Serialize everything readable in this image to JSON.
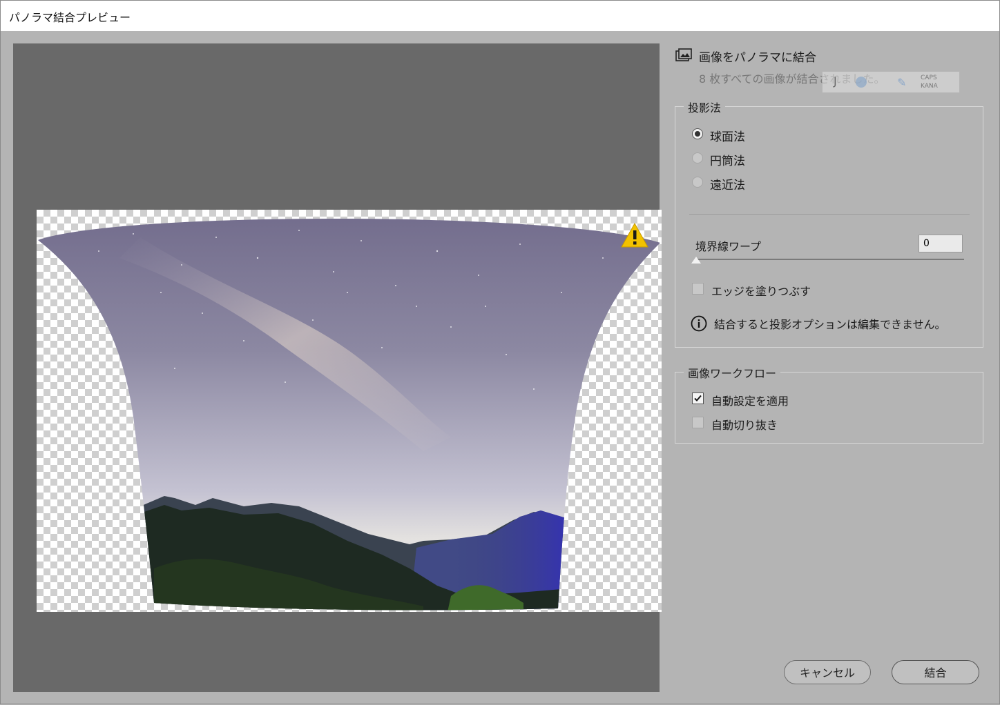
{
  "window": {
    "title": "パノラマ結合プレビュー"
  },
  "panel": {
    "header": "画像をパノラマに結合",
    "status": "8 枚すべての画像が結合されました。"
  },
  "ime": {
    "mode": "J",
    "caps_line1": "CAPS",
    "caps_line2": "KANA"
  },
  "projection": {
    "legend": "投影法",
    "options": [
      {
        "label": "球面法",
        "selected": true
      },
      {
        "label": "円筒法",
        "selected": false
      },
      {
        "label": "遠近法",
        "selected": false
      }
    ],
    "boundary_warp_label": "境界線ワープ",
    "boundary_warp_value": "0",
    "fill_edges_label": "エッジを塗りつぶす",
    "fill_edges_checked": false,
    "info_text": "結合すると投影オプションは編集できません。"
  },
  "workflow": {
    "legend": "画像ワークフロー",
    "auto_settings_label": "自動設定を適用",
    "auto_settings_checked": true,
    "auto_crop_label": "自動切り抜き",
    "auto_crop_checked": false
  },
  "buttons": {
    "cancel": "キャンセル",
    "merge": "結合"
  },
  "colors": {
    "warning": "#f2c200",
    "preview_bg": "#696969",
    "panel_bg": "#b4b4b4"
  }
}
